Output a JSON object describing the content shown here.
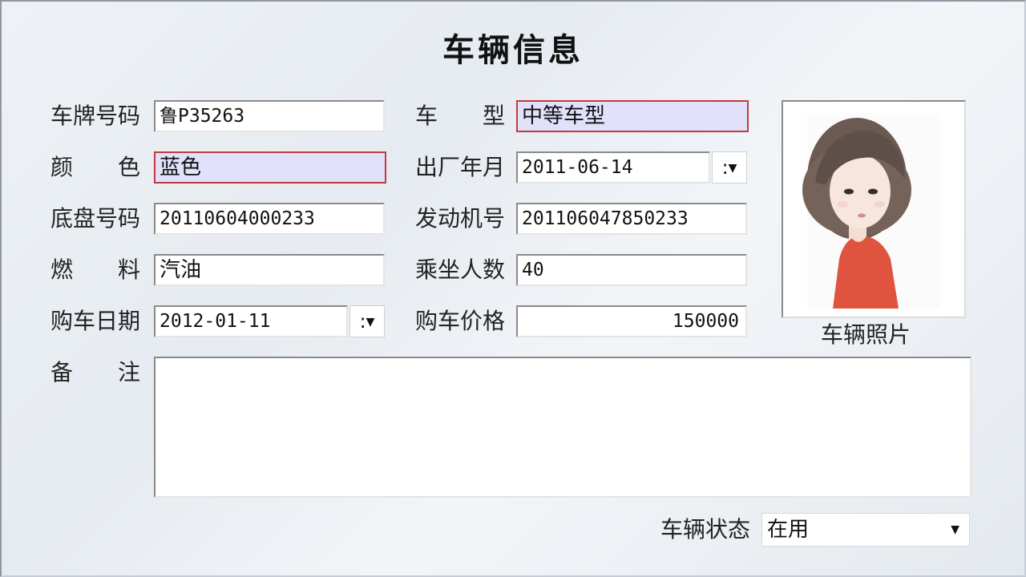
{
  "form": {
    "title": "车辆信息",
    "labels": {
      "plate": "车牌号码",
      "model": "车　　型",
      "color": "颜　　色",
      "manufacture_date": "出厂年月",
      "chassis_no": "底盘号码",
      "engine_no": "发动机号",
      "fuel": "燃　　料",
      "seats": "乘坐人数",
      "purchase_date": "购车日期",
      "price": "购车价格",
      "remarks": "备　　注",
      "photo": "车辆照片",
      "status": "车辆状态"
    },
    "values": {
      "plate": "鲁P35263",
      "model": "中等车型",
      "color": "蓝色",
      "manufacture_date": "2011-06-14",
      "chassis_no": "20110604000233",
      "engine_no": "201106047850233",
      "fuel": "汽油",
      "seats": "40",
      "purchase_date": "2012-01-11",
      "price": "150000",
      "remarks": "",
      "status": "在用"
    },
    "date_picker_glyph": ":",
    "highlight_border": "#c43a40",
    "highlight_fill": "#e2e1fb"
  },
  "icons": {
    "dropdown": "chevron-down-icon",
    "photo": "portrait-photo"
  }
}
